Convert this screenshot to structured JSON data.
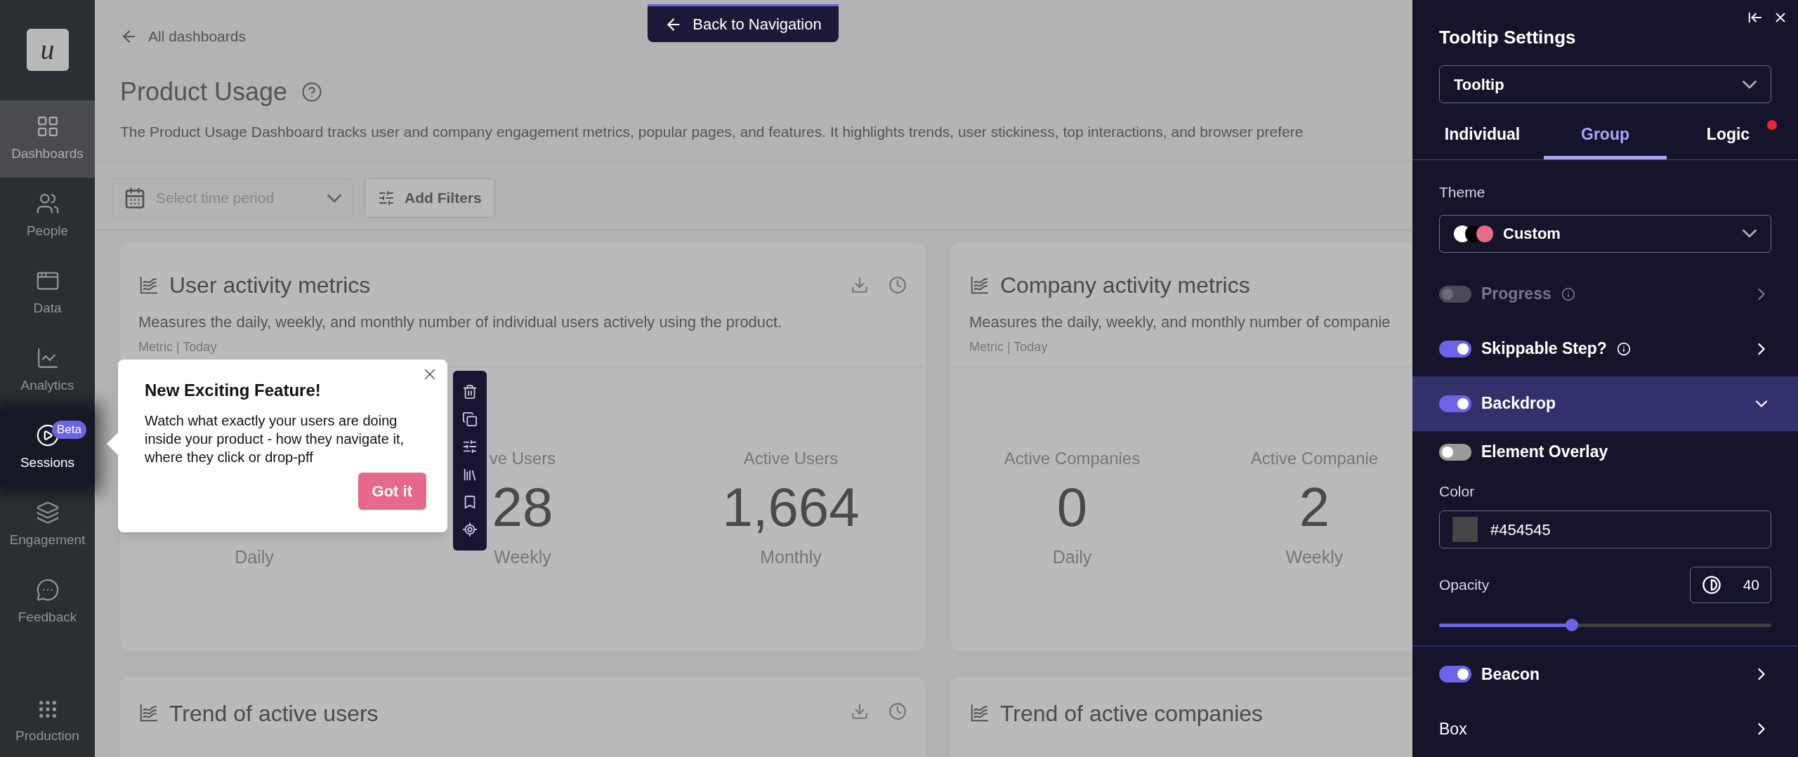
{
  "sidebar": {
    "logo": "u",
    "items": [
      {
        "label": "Dashboards",
        "kind": "dashboards",
        "selected": true,
        "spotlight": false
      },
      {
        "label": "People",
        "kind": "people",
        "selected": false,
        "spotlight": false
      },
      {
        "label": "Data",
        "kind": "data",
        "selected": false,
        "spotlight": false
      },
      {
        "label": "Analytics",
        "kind": "analytics",
        "selected": false,
        "spotlight": false
      },
      {
        "label": "Sessions",
        "kind": "sessions",
        "selected": false,
        "spotlight": true,
        "badge": "Beta"
      },
      {
        "label": "Engagement",
        "kind": "engagement",
        "selected": false,
        "spotlight": false
      },
      {
        "label": "Feedback",
        "kind": "feedback",
        "selected": false,
        "spotlight": false
      }
    ],
    "bottom_item": {
      "label": "Production"
    }
  },
  "top_button": {
    "label": "Back to Navigation"
  },
  "header": {
    "back_link": "All dashboards",
    "title": "Product Usage",
    "description": "The Product Usage Dashboard tracks user and company engagement metrics, popular pages, and features. It highlights trends, user stickiness, top interactions, and browser prefere"
  },
  "filters": {
    "time_period": {
      "placeholder": "Select time period"
    },
    "add_filters": "Add Filters"
  },
  "cards": [
    {
      "title": "User activity metrics",
      "description": "Measures the daily, weekly, and monthly number of individual users actively using the product.",
      "meta": "Metric | Today",
      "actions": true,
      "metrics": [
        {
          "caption": "Daily"
        },
        {
          "label": "ve Users",
          "value": "28",
          "caption": "Weekly"
        },
        {
          "label": "Active Users",
          "value": "1,664",
          "caption": "Monthly"
        }
      ]
    },
    {
      "title": "Company activity metrics",
      "description": "Measures the daily, weekly, and monthly number of companie",
      "meta": "Metric | Today",
      "metrics": [
        {
          "label": "Active Companies",
          "value": "0",
          "caption": "Daily"
        },
        {
          "label": "Active Companie",
          "value": "2",
          "caption": "Weekly"
        }
      ]
    }
  ],
  "trend_cards": [
    {
      "title": "Trend of active users",
      "actions": true
    },
    {
      "title": "Trend of active companies"
    }
  ],
  "tooltip_popup": {
    "title": "New Exciting Feature!",
    "body": "Watch what exactly your users are doing inside your product - how they navigate it, where they click or drop-pff",
    "button": "Got it"
  },
  "panel": {
    "title": "Tooltip Settings",
    "type_select": "Tooltip",
    "tabs": [
      {
        "label": "Individual",
        "selected": false,
        "alert": false
      },
      {
        "label": "Group",
        "selected": true,
        "alert": false
      },
      {
        "label": "Logic",
        "selected": false,
        "alert": true
      }
    ],
    "theme": {
      "label": "Theme",
      "value": "Custom",
      "swatches": [
        {
          "color": "#ffffff"
        },
        {
          "color": "#000000"
        },
        {
          "color": "#e66a8c"
        }
      ]
    },
    "rows": [
      {
        "kind": "toggle",
        "label": "Progress",
        "on": false,
        "disabled": true,
        "info": true,
        "expanded": false
      },
      {
        "kind": "toggle",
        "label": "Skippable Step?",
        "on": true,
        "disabled": false,
        "info": true,
        "expanded": false
      },
      {
        "kind": "toggle",
        "label": "Backdrop",
        "on": true,
        "disabled": false,
        "info": false,
        "expanded": true
      },
      {
        "kind": "toggle",
        "label": "Beacon",
        "on": true,
        "disabled": false,
        "info": false,
        "expanded": false
      },
      {
        "kind": "link",
        "label": "Box",
        "disabled": false,
        "info": false,
        "expanded": false
      }
    ],
    "backdrop_settings": {
      "element_overlay": {
        "label": "Element Overlay",
        "on": false
      },
      "color": {
        "label": "Color",
        "value": "#454545"
      },
      "opacity": {
        "label": "Opacity",
        "reading": "40",
        "level": 0.4
      }
    }
  }
}
